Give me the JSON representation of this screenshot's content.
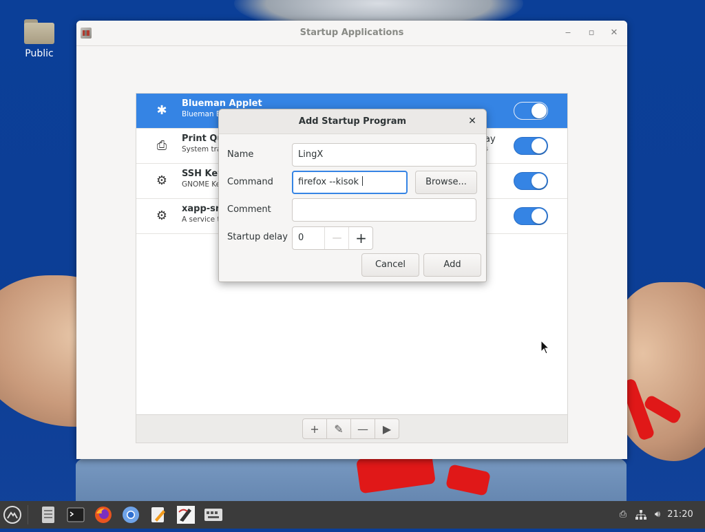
{
  "desktop": {
    "icons": [
      {
        "label": "Public",
        "icon": "folder-icon"
      }
    ]
  },
  "window": {
    "title": "Startup Applications",
    "controls": {
      "minimize": "‒",
      "maximize": "▫",
      "close": "✕"
    },
    "apps": [
      {
        "name": "Blueman Applet",
        "description": "Blueman Bl",
        "enabled": true,
        "selected": true,
        "icon": "bluetooth-icon"
      },
      {
        "name": "Print Qu",
        "description": "System tra",
        "extra": "ay",
        "extra2": "s",
        "enabled": true,
        "selected": false,
        "icon": "printer-icon"
      },
      {
        "name": "SSH Key",
        "description": "GNOME Ke",
        "enabled": true,
        "selected": false,
        "icon": "gears-icon"
      },
      {
        "name": "xapp-sn",
        "description": "A service th",
        "enabled": true,
        "selected": false,
        "icon": "gears-icon"
      }
    ],
    "toolbar": {
      "add": "+",
      "edit": "✎",
      "remove": "—",
      "run": "▶"
    }
  },
  "dialog": {
    "title": "Add Startup Program",
    "close": "✕",
    "name_label": "Name",
    "name_value": "LingX",
    "command_label": "Command",
    "command_value": "firefox --kisok ",
    "browse_label": "Browse...",
    "comment_label": "Comment",
    "comment_value": "",
    "delay_label": "Startup delay",
    "delay_value": "0",
    "delay_minus": "—",
    "delay_plus": "+",
    "cancel_label": "Cancel",
    "add_label": "Add"
  },
  "taskbar": {
    "items": [
      "menu-icon",
      "files-icon",
      "terminal-icon",
      "firefox-icon",
      "chromium-icon",
      "text-editor-icon",
      "pen-app-icon",
      "keyboard-app-icon"
    ],
    "clock": "21:20"
  }
}
